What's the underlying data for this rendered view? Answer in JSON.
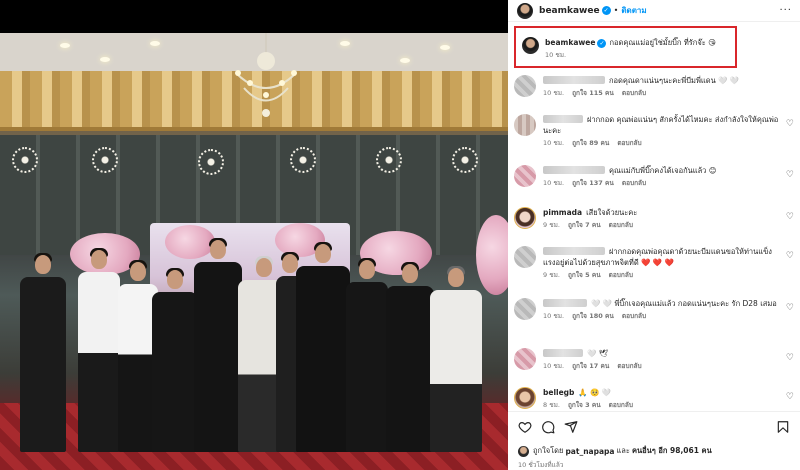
{
  "post": {
    "username": "beamkawee",
    "follow_label": "ติดตาม",
    "more_label": "···",
    "caption": {
      "text": "กอดคุณแม่อยู่ใช่มั้ยบิ๊ก ที่รักจ๊ะ 😘",
      "time": "10 ชม."
    }
  },
  "comments": [
    {
      "type": "blurred",
      "text": "กอดคุณดาแน่นๆนะคะพี่บีมพี่แดน 🤍 🤍",
      "time": "10 ชม.",
      "likes": "ถูกใจ 115 คน",
      "reply": "ตอบกลับ"
    },
    {
      "type": "blurred",
      "text": "ฝากกอด คุณพ่อแน่นๆ สักครั้งได้ไหมคะ ส่งกำลังใจให้คุณพ่อนะคะ",
      "time": "10 ชม.",
      "likes": "ถูกใจ 89 คน",
      "reply": "ตอบกลับ"
    },
    {
      "type": "blurred",
      "text": "คุณแม่กับพี่บิ๊กคงได้เจอกันแล้ว 😊",
      "time": "10 ชม.",
      "likes": "ถูกใจ 137 คน",
      "reply": "ตอบกลับ"
    },
    {
      "type": "named",
      "name": "pimmada",
      "text": "เสียใจด้วยนะคะ",
      "time": "9 ชม.",
      "likes": "ถูกใจ 7 คน",
      "reply": "ตอบกลับ"
    },
    {
      "type": "blurred",
      "text": "ฝากกอดคุณพ่อคุณดาด้วยนะบีมแดนขอให้ท่านแข็งแรงอยู่ต่อไปด้วยสุขภาพจิตที่ดี ❤️ ❤️ ❤️",
      "time": "9 ชม.",
      "likes": "ถูกใจ 5 คน",
      "reply": "ตอบกลับ"
    },
    {
      "type": "blurred",
      "text": "🤍 🤍 พี่บิ๊กเจอคุณแม่แล้ว กอดแน่นๆนะคะ รัก D28 เสมอ",
      "time": "10 ชม.",
      "likes": "ถูกใจ 180 คน",
      "reply": "ตอบกลับ"
    },
    {
      "type": "blurred",
      "text": "🤍 🕊",
      "time": "10 ชม.",
      "likes": "ถูกใจ 17 คน",
      "reply": "ตอบกลับ"
    },
    {
      "type": "named",
      "name": "bellegb",
      "text": "🙏 🥺 🤍",
      "time": "8 ชม.",
      "likes": "ถูกใจ 3 คน",
      "reply": "ตอบกลับ"
    }
  ],
  "footer": {
    "liked_by_prefix": "ถูกใจโดย",
    "liked_by_user": "pat_napapa",
    "liked_by_and": "และ",
    "liked_by_others": "คนอื่นๆ อีก 98,061 คน",
    "time_ago": "10 ชั่วโมงที่แล้ว"
  },
  "icons": {
    "header_avatar": "avatar-beamkawee",
    "verified": "verified-badge-icon",
    "like": "heart-icon",
    "comment": "comment-icon",
    "share": "send-icon",
    "save": "bookmark-icon"
  },
  "colors": {
    "verified": "#0095f6",
    "follow": "#0095f6",
    "highlight_box": "#d9262b",
    "muted": "#737373"
  }
}
